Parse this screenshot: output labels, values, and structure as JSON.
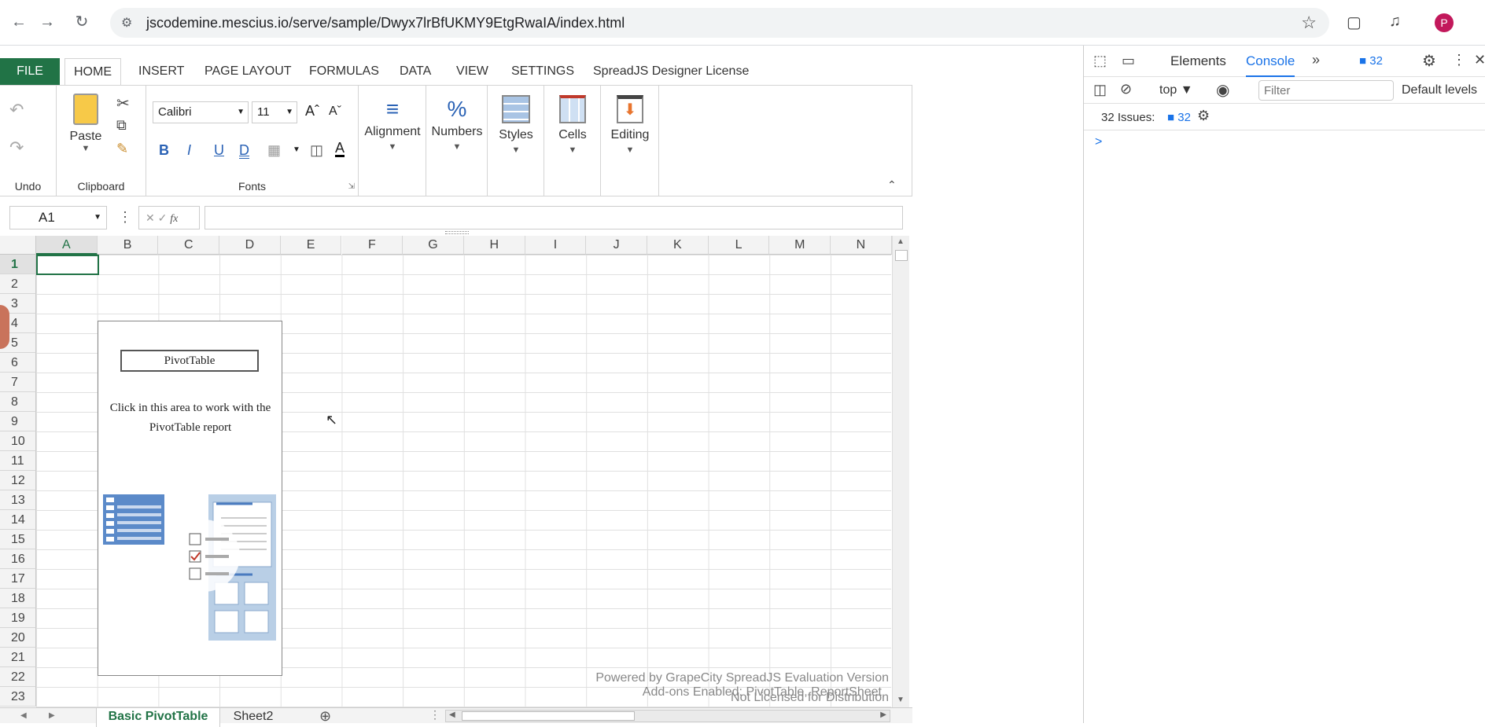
{
  "browser": {
    "url": "jscodemine.mescius.io/serve/sample/Dwyx7lrBfUKMY9EtgRwaIA/index.html",
    "avatar_letter": "P"
  },
  "ribbon": {
    "tabs": [
      "FILE",
      "HOME",
      "INSERT",
      "PAGE LAYOUT",
      "FORMULAS",
      "DATA",
      "VIEW",
      "SETTINGS",
      "SpreadJS Designer License"
    ],
    "active_tab": "HOME",
    "groups": {
      "undo": "Undo",
      "clipboard": "Clipboard",
      "paste": "Paste",
      "fonts": "Fonts",
      "font_name": "Calibri",
      "font_size": "11",
      "alignment": "Alignment",
      "numbers": "Numbers",
      "styles": "Styles",
      "cells": "Cells",
      "editing": "Editing"
    },
    "accent_color": "#217346"
  },
  "formula_bar": {
    "name_box": "A1",
    "fx": "fx",
    "formula": ""
  },
  "grid": {
    "columns": [
      "A",
      "B",
      "C",
      "D",
      "E",
      "F",
      "G",
      "H",
      "I",
      "J",
      "K",
      "L",
      "M",
      "N"
    ],
    "rows": [
      "1",
      "2",
      "3",
      "4",
      "5",
      "6",
      "7",
      "8",
      "9",
      "10",
      "11",
      "12",
      "13",
      "14",
      "15",
      "16",
      "17",
      "18",
      "19",
      "20",
      "21",
      "22",
      "23"
    ],
    "selected_cell": "A1"
  },
  "pivot": {
    "title": "PivotTable",
    "message": "Click in this area to work with the PivotTable report"
  },
  "watermark": {
    "line1": "Powered by GrapeCity SpreadJS Evaluation Version",
    "line2": "Not Licensed for Distribution",
    "line3": "Add-ons Enabled: PivotTable, ReportSheet"
  },
  "sheets": {
    "tabs": [
      "Basic PivotTable",
      "Sheet2"
    ],
    "active": "Basic PivotTable"
  },
  "devtools": {
    "tabs": [
      "Elements",
      "Console"
    ],
    "active_tab": "Console",
    "issues_badge": "32",
    "context": "top",
    "filter_placeholder": "Filter",
    "levels": "Default levels",
    "issues_text": "32 Issues:",
    "issues_count": "32",
    "prompt": ">"
  }
}
